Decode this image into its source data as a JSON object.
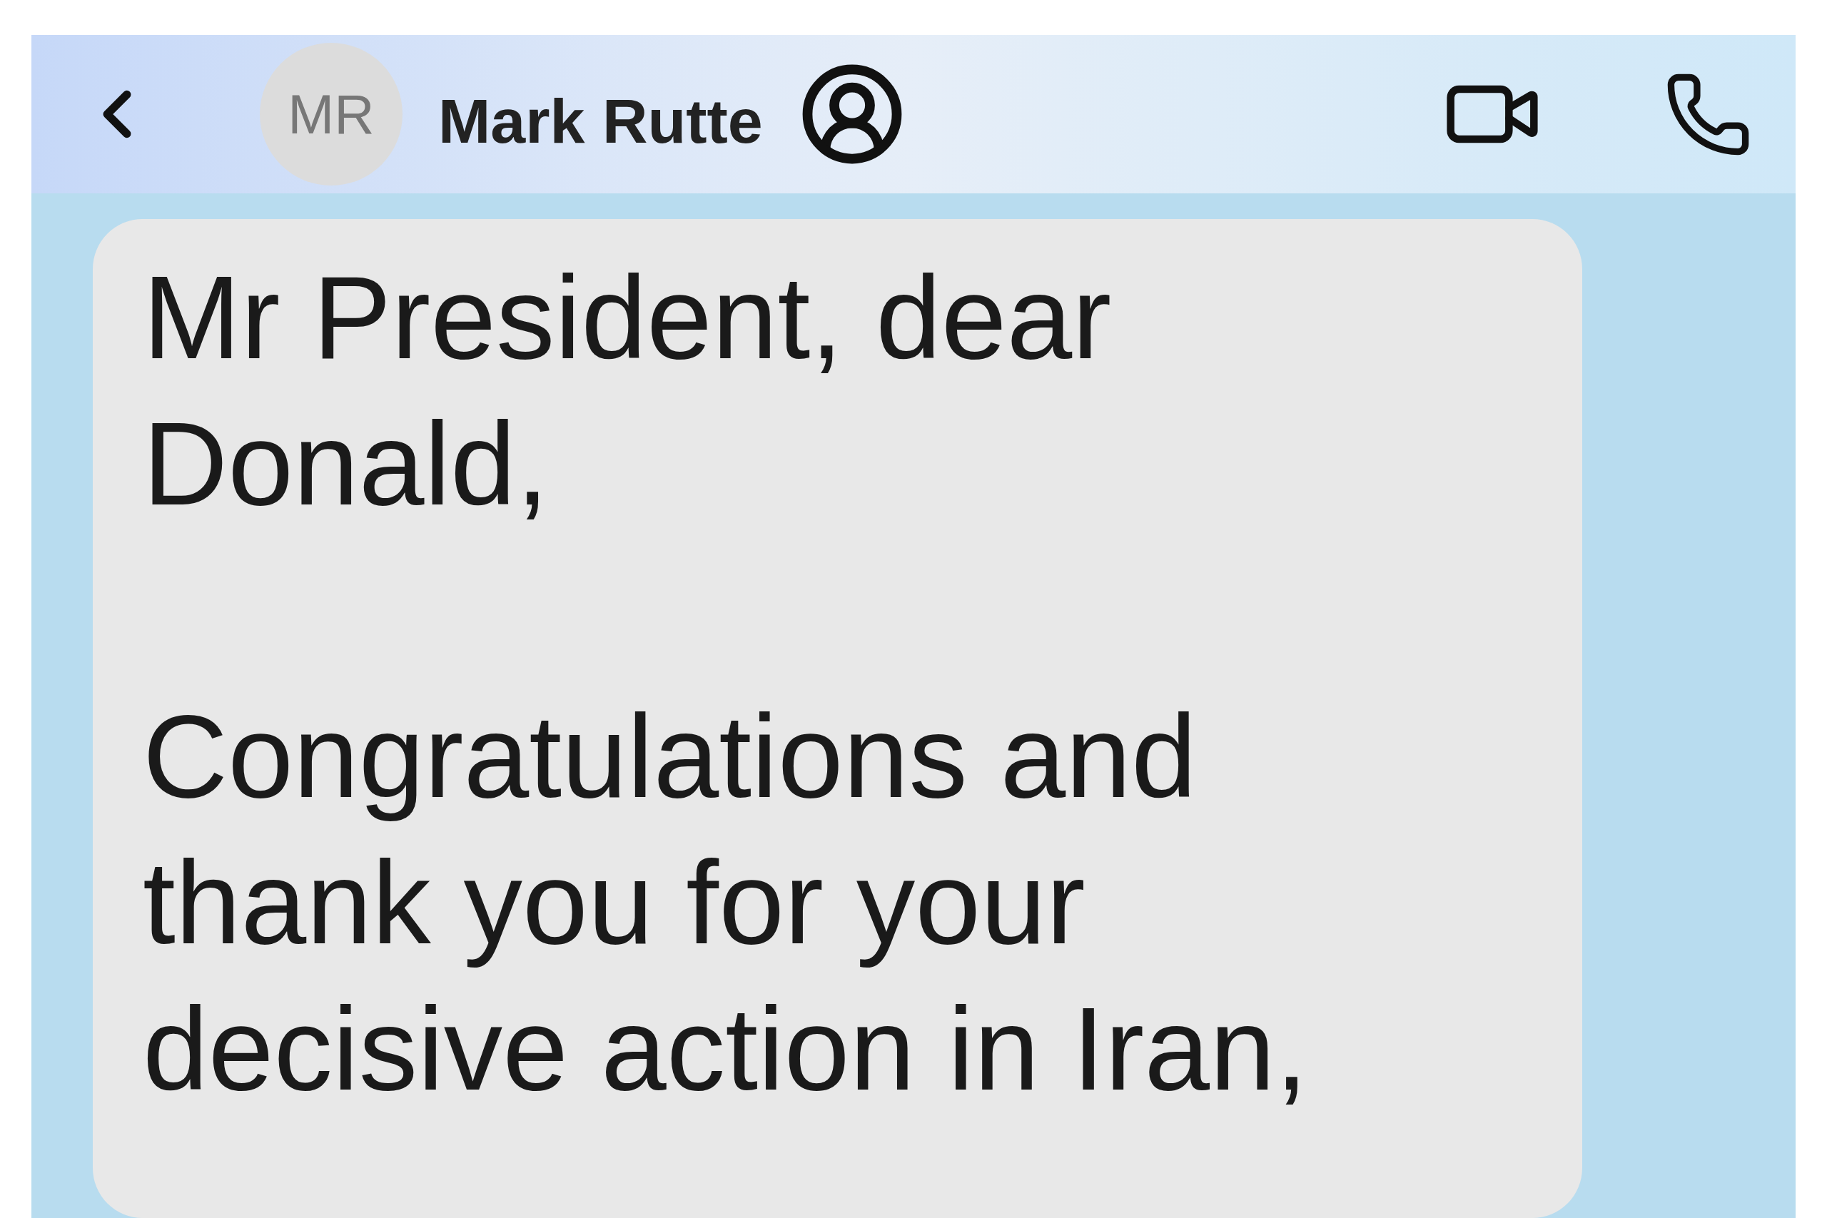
{
  "header": {
    "avatar_initials": "MR",
    "contact_name": "Mark Rutte"
  },
  "messages": [
    {
      "text": "Mr President, dear\nDonald,\n\nCongratulations and\nthank you for your\ndecisive action in Iran,"
    }
  ]
}
